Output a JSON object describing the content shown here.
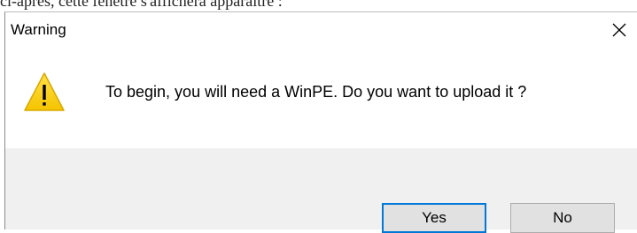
{
  "background": {
    "caption": "ci-après, cette fenêtre s'affichera apparaître :"
  },
  "dialog": {
    "title": "Warning",
    "message": "To begin, you will need a WinPE. Do you want to upload it ?",
    "icon": "warning-triangle-icon",
    "buttons": {
      "yes": "Yes",
      "no": "No"
    },
    "accent_color": "#0078d7",
    "warning_color": "#ffd21f"
  }
}
